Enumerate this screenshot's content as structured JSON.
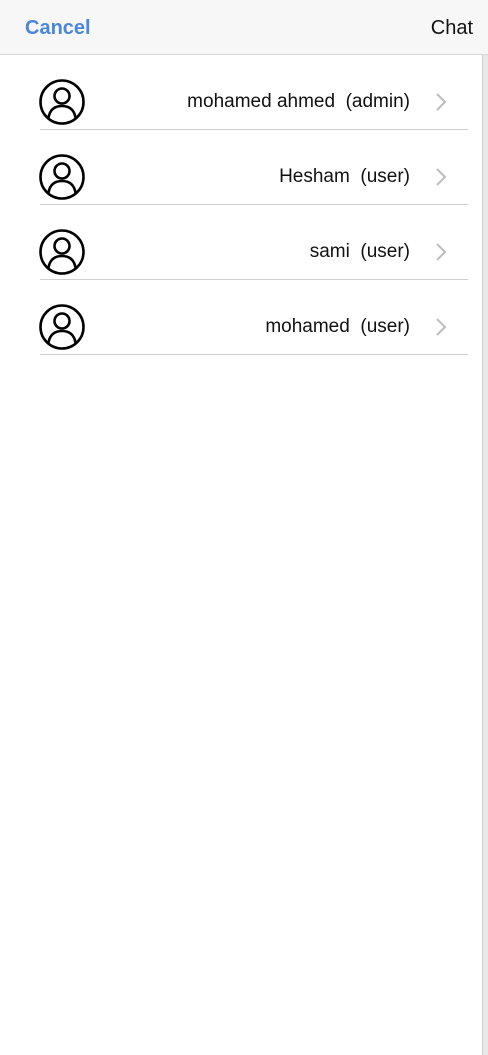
{
  "header": {
    "cancel_label": "Cancel",
    "title": "Chat"
  },
  "members": [
    {
      "label": "mohamed ahmed  (admin)"
    },
    {
      "label": "Hesham  (user)"
    },
    {
      "label": "sami  (user)"
    },
    {
      "label": "mohamed  (user)"
    }
  ],
  "icons": {
    "avatar": "user-circle-icon",
    "row_arrow": "chevron-right-icon"
  },
  "colors": {
    "accent": "#4a86d9",
    "header_bg": "#f7f7f7",
    "divider": "#cfcfcf",
    "chevron": "#bdbdbd"
  }
}
